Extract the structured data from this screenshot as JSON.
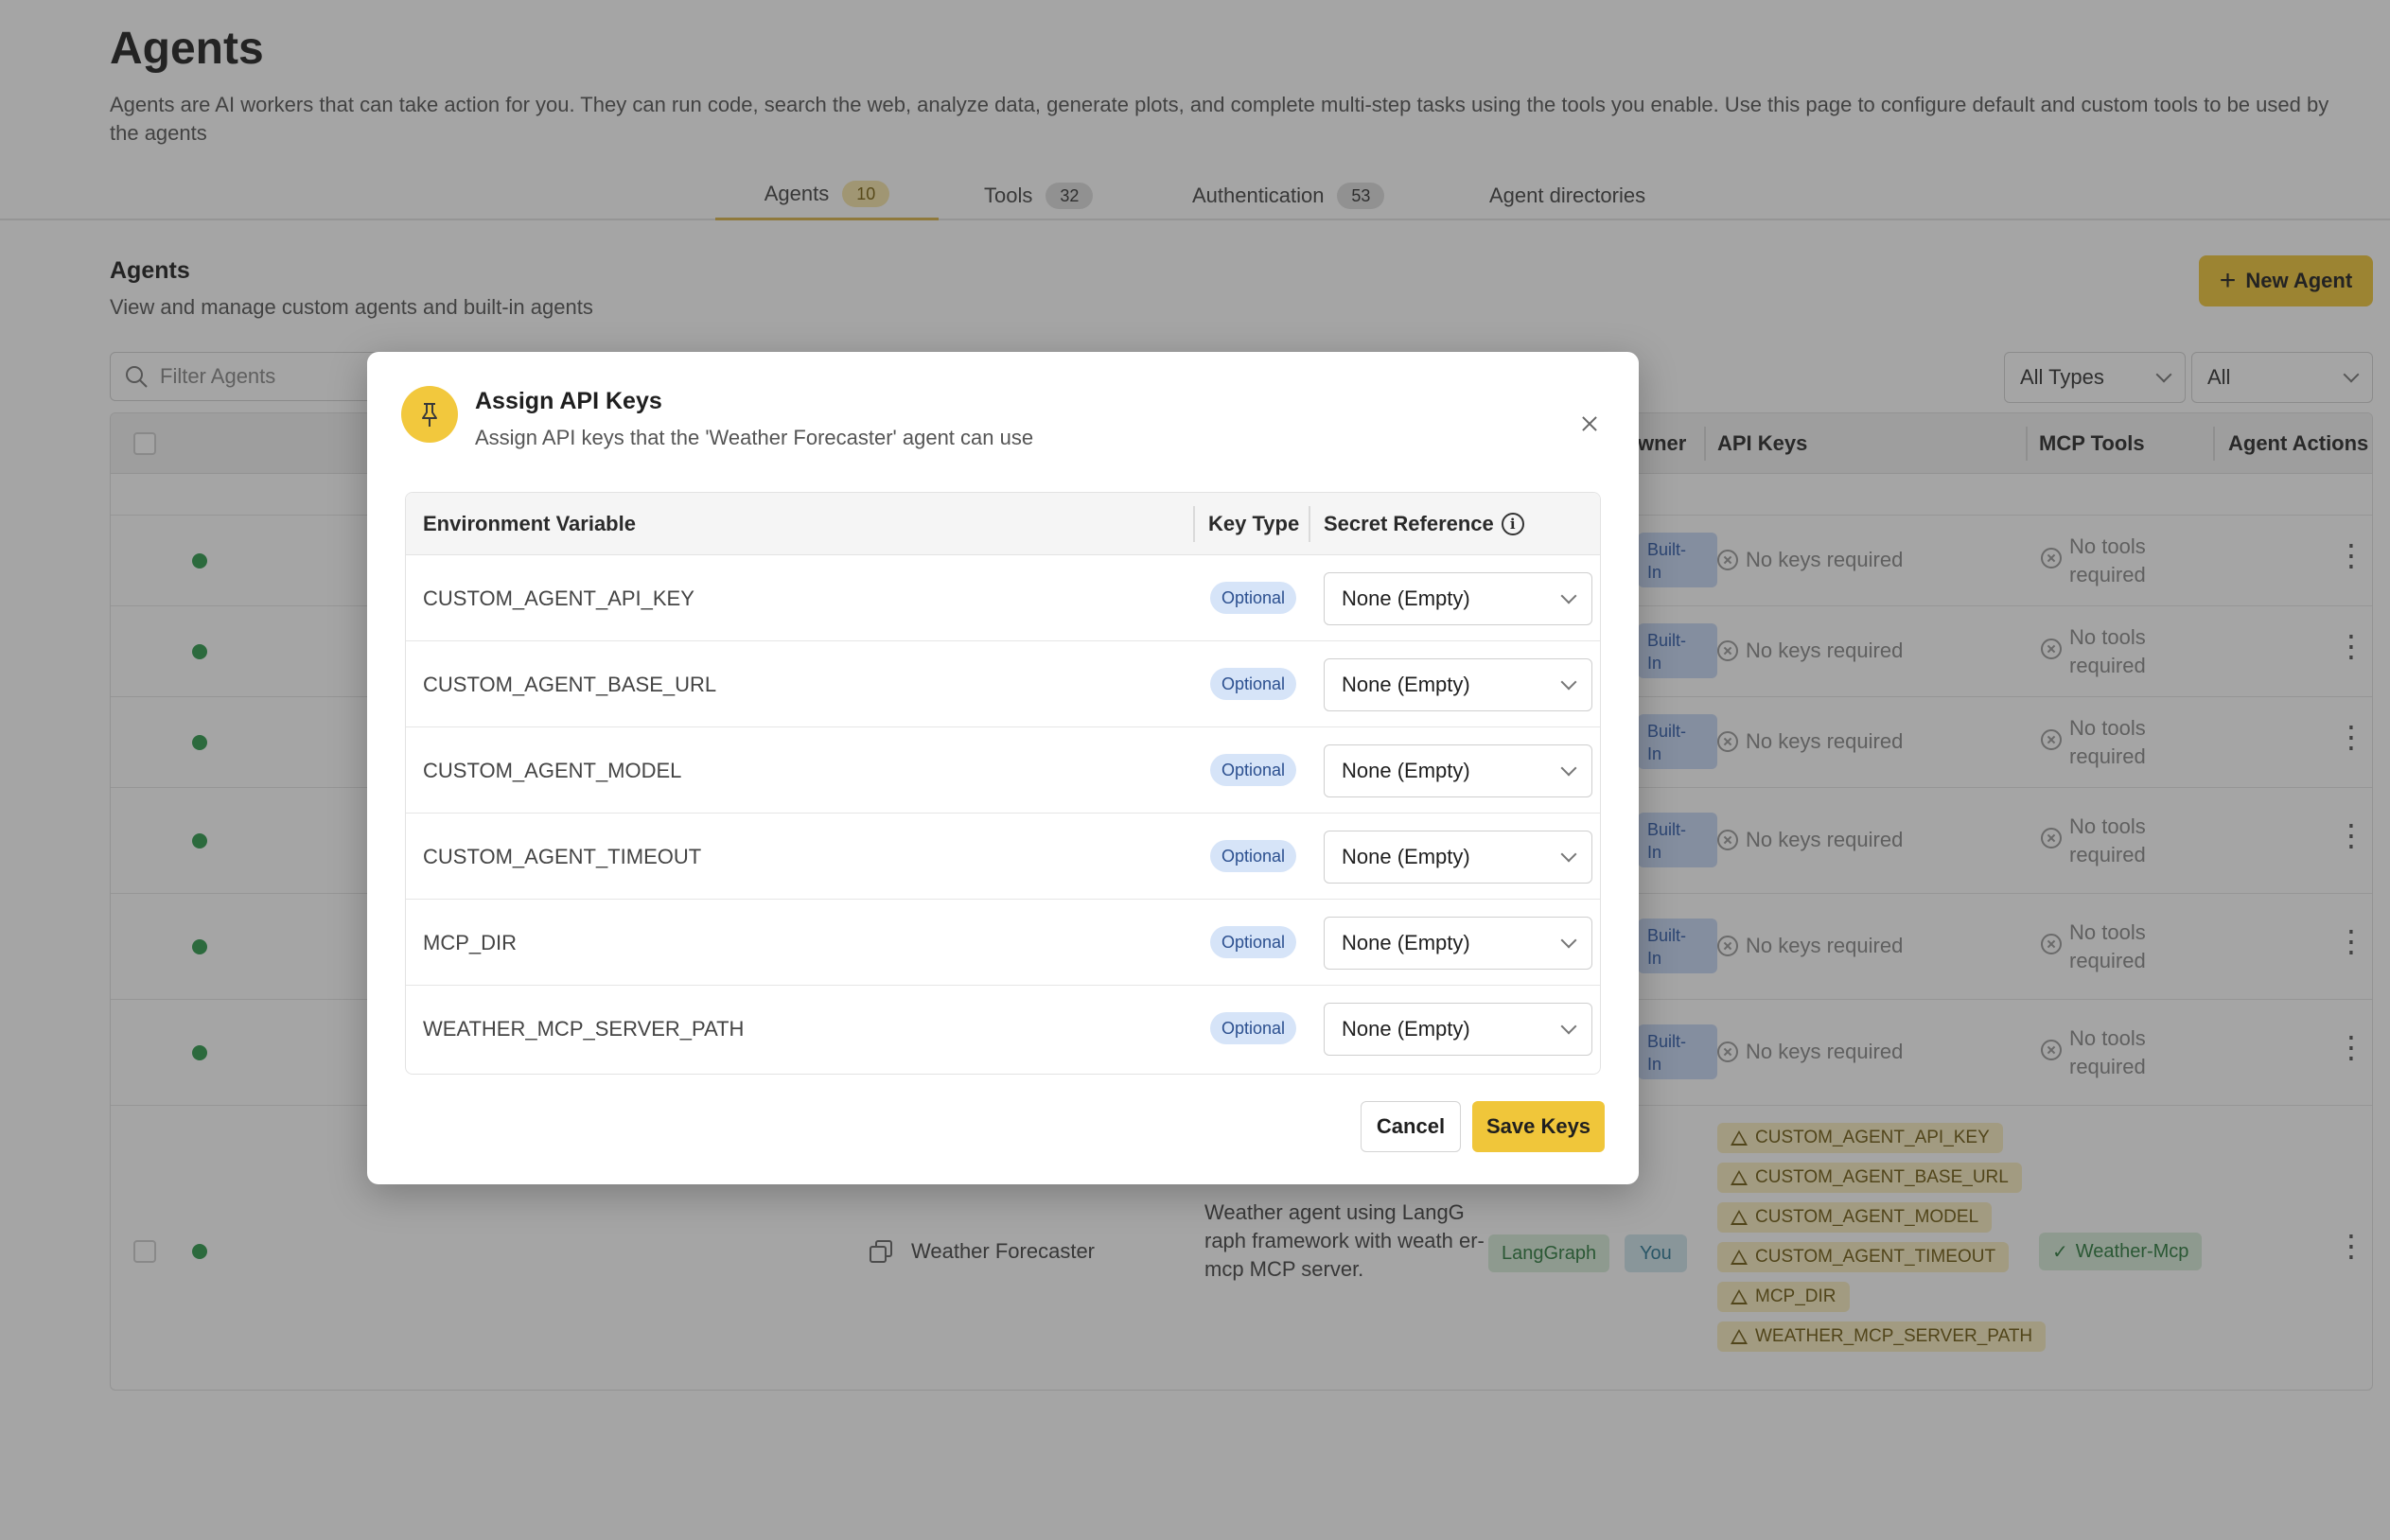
{
  "page": {
    "title": "Agents",
    "description": "Agents are AI workers that can take action for you. They can run code, search the web, analyze data, generate plots, and complete multi-step tasks using the tools you enable. Use this page to configure default and custom tools to be used by the agents"
  },
  "tabs": [
    {
      "label": "Agents",
      "count": "10"
    },
    {
      "label": "Tools",
      "count": "32"
    },
    {
      "label": "Authentication",
      "count": "53"
    },
    {
      "label": "Agent directories",
      "count": ""
    }
  ],
  "section": {
    "title": "Agents",
    "description": "View and manage custom agents and built-in agents",
    "new_agent_label": "New Agent"
  },
  "filters": {
    "search_placeholder": "Filter Agents",
    "type_select": "All Types",
    "other_select": "All"
  },
  "table": {
    "headers": {
      "owner": "wner",
      "api_keys": "API Keys",
      "mcp_tools": "MCP Tools",
      "agent_actions": "Agent Actions"
    },
    "builtin_label": "Built-\nIn",
    "no_keys_label": "No keys required",
    "no_tools_label": "No tools\nrequired",
    "last_row": {
      "name": "Weather Forecaster",
      "description": "Weather agent using LangG raph framework with weath er-mcp MCP server.",
      "framework": "LangGraph",
      "owner": "You",
      "keys": [
        "CUSTOM_AGENT_API_KEY",
        "CUSTOM_AGENT_BASE_URL",
        "CUSTOM_AGENT_MODEL",
        "CUSTOM_AGENT_TIMEOUT",
        "MCP_DIR",
        "WEATHER_MCP_SERVER_PATH"
      ],
      "mcp_tool": "Weather-Mcp"
    }
  },
  "modal": {
    "title": "Assign API Keys",
    "subtitle": "Assign API keys that the 'Weather Forecaster' agent can use",
    "headers": {
      "env_var": "Environment Variable",
      "key_type": "Key Type",
      "secret_ref": "Secret Reference"
    },
    "rows": [
      {
        "name": "CUSTOM_AGENT_API_KEY",
        "type": "Optional",
        "secret": "None (Empty)"
      },
      {
        "name": "CUSTOM_AGENT_BASE_URL",
        "type": "Optional",
        "secret": "None (Empty)"
      },
      {
        "name": "CUSTOM_AGENT_MODEL",
        "type": "Optional",
        "secret": "None (Empty)"
      },
      {
        "name": "CUSTOM_AGENT_TIMEOUT",
        "type": "Optional",
        "secret": "None (Empty)"
      },
      {
        "name": "MCP_DIR",
        "type": "Optional",
        "secret": "None (Empty)"
      },
      {
        "name": "WEATHER_MCP_SERVER_PATH",
        "type": "Optional",
        "secret": "None (Empty)"
      }
    ],
    "cancel_label": "Cancel",
    "save_label": "Save Keys"
  },
  "colors": {
    "accent": "#f0c63a",
    "status_active": "#2f9a4d",
    "builtin_badge": "#c7d8f5",
    "optional_badge": "#d6e4f8",
    "key_warning": "#faeec2"
  }
}
